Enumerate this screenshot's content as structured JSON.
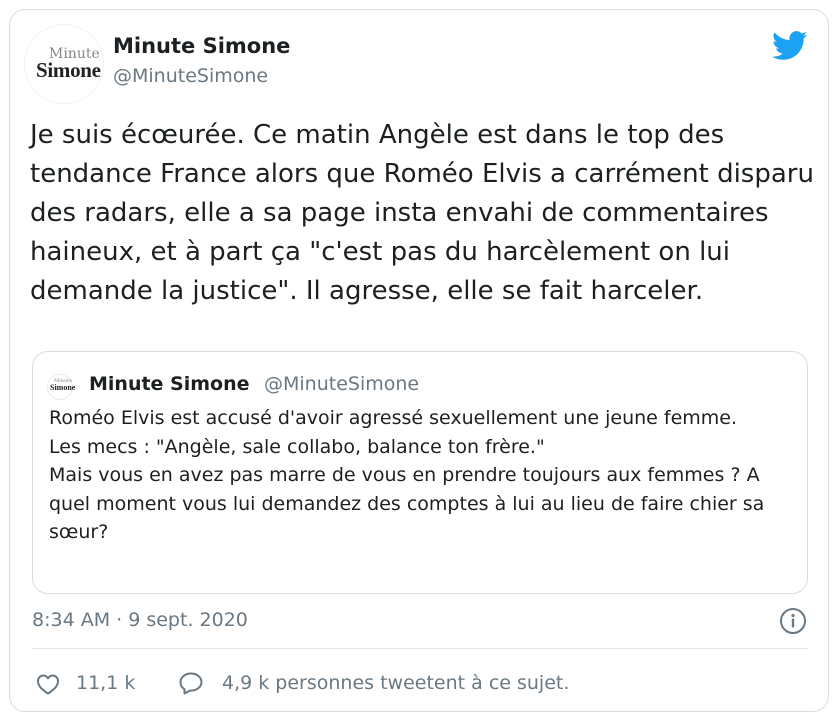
{
  "colors": {
    "twitter_blue": "#1da1f2",
    "text": "#1c2022",
    "secondary": "#697882",
    "border": "#d6dee5"
  },
  "author": {
    "avatar_line1": "Minute",
    "avatar_line2": "Simone",
    "name": "Minute Simone",
    "handle": "@MinuteSimone"
  },
  "tweet": {
    "text": "Je suis écœurée. Ce matin Angèle est dans le top des tendance France alors que Roméo Elvis a carrément disparu des radars, elle a sa page insta envahi de commentaires haineux, et à part ça \"c'est pas du harcèlement on lui demande la justice\". Il agresse, elle se fait harceler.",
    "timestamp": "8:34 AM · 9 sept. 2020"
  },
  "quoted": {
    "avatar_line1": "Minute",
    "avatar_line2": "Simone",
    "name": "Minute Simone",
    "handle": "@MinuteSimone",
    "text": "Roméo Elvis est accusé d'avoir agressé sexuellement une jeune femme.\nLes mecs : \"Angèle, sale collabo, balance ton frère.\"\nMais vous en avez pas marre de vous en prendre toujours aux femmes ? A quel moment vous lui demandez des comptes à lui au lieu de faire chier sa sœur?"
  },
  "actions": {
    "likes": "11,1 k",
    "retweets": "4,9 k personnes tweetent à ce sujet."
  },
  "icons": {
    "brand": "twitter-bird-icon",
    "info": "info-icon",
    "like": "heart-icon",
    "reply": "speech-bubble-icon"
  }
}
